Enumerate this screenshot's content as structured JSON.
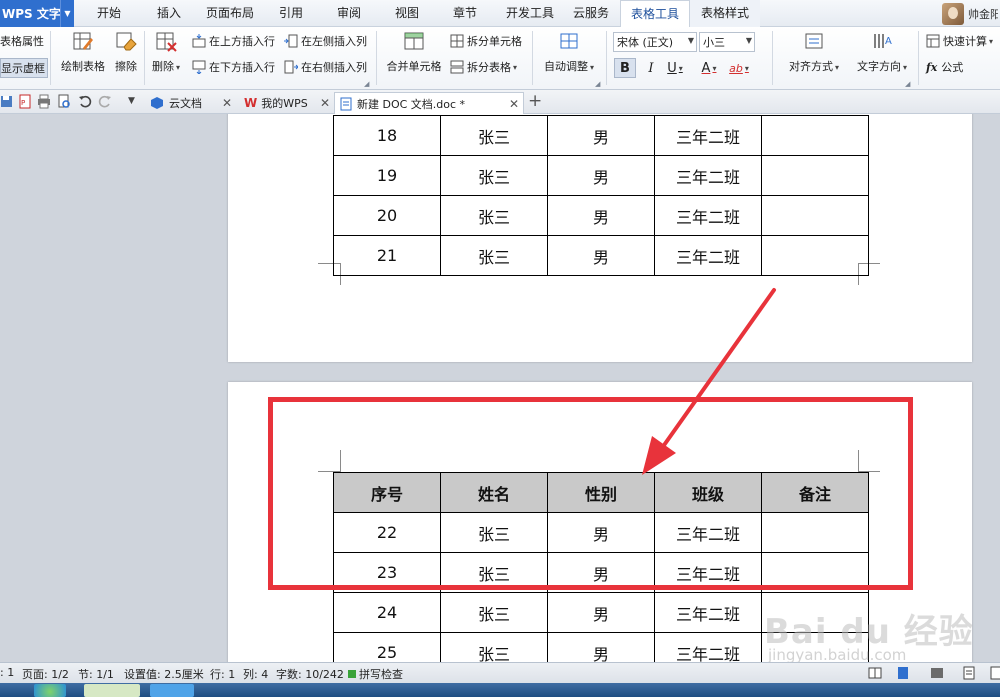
{
  "menubar": {
    "app_name": "WPS 文字",
    "tabs": [
      "开始",
      "插入",
      "页面布局",
      "引用",
      "审阅",
      "视图",
      "章节",
      "开发工具",
      "云服务",
      "表格工具",
      "表格样式"
    ],
    "active_tab": "表格工具",
    "user_name": "帅金阳"
  },
  "ribbon": {
    "table_props": "表格属性",
    "show_gridlines": "显示虚框",
    "draw_table": "绘制表格",
    "eraser": "擦除",
    "delete": "删除",
    "insert_above": "在上方插入行",
    "insert_below": "在下方插入行",
    "insert_left": "在左侧插入列",
    "insert_right": "在右侧插入列",
    "merge_cells": "合并单元格",
    "split_cells": "拆分单元格",
    "split_table": "拆分表格",
    "auto_adjust": "自动调整",
    "font_name": "宋体 (正文)",
    "font_size": "小三",
    "bold": "B",
    "italic": "I",
    "underline": "U",
    "font_color": "A",
    "highlight": "ab",
    "align": "对齐方式",
    "text_direction": "文字方向",
    "quick_calc": "快速计算",
    "formula": "公式"
  },
  "doc_tabs": [
    {
      "label": "云文档",
      "active": false
    },
    {
      "label": "我的WPS",
      "active": false
    },
    {
      "label": "新建 DOC 文档.doc *",
      "active": true
    }
  ],
  "table_page1": {
    "rows": [
      [
        "18",
        "张三",
        "男",
        "三年二班",
        ""
      ],
      [
        "19",
        "张三",
        "男",
        "三年二班",
        ""
      ],
      [
        "20",
        "张三",
        "男",
        "三年二班",
        ""
      ],
      [
        "21",
        "张三",
        "男",
        "三年二班",
        ""
      ]
    ]
  },
  "table_page2": {
    "headers": [
      "序号",
      "姓名",
      "性别",
      "班级",
      "备注"
    ],
    "rows": [
      [
        "22",
        "张三",
        "男",
        "三年二班",
        ""
      ],
      [
        "23",
        "张三",
        "男",
        "三年二班",
        ""
      ],
      [
        "24",
        "张三",
        "男",
        "三年二班",
        ""
      ],
      [
        "25",
        "张三",
        "男",
        "三年二班",
        ""
      ]
    ]
  },
  "annotation": {
    "highlight_color": "#e8333b"
  },
  "watermark": {
    "logo": "Bai du 经验",
    "url": "jingyan.baidu.com"
  },
  "statusbar": {
    "row_label": ": 1",
    "page": "页面: 1/2",
    "section": "节: 1/1",
    "setting": "设置值: 2.5厘米",
    "line": "行: 1",
    "col": "列: 4",
    "wordcount": "字数: 10/242",
    "spellcheck": "拼写检查"
  }
}
